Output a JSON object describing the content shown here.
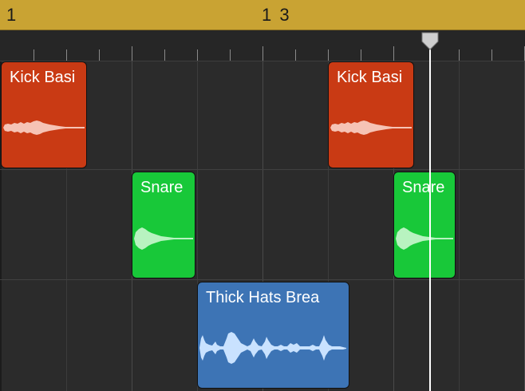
{
  "cycle_bar": {
    "start_label": "1",
    "marker_label": "1 3"
  },
  "regions": {
    "kick_1": {
      "name": "Kick Basi"
    },
    "kick_2": {
      "name": "Kick Basi"
    },
    "snare_1": {
      "name": "Snare"
    },
    "snare_2": {
      "name": "Snare"
    },
    "hats_1": {
      "name": "Thick Hats Brea"
    }
  },
  "colors": {
    "cycle_bar": "#c9a333",
    "kick_region": "#c93a14",
    "snare_region": "#18c839",
    "hats_region": "#3d74b5",
    "playhead": "#ffffff"
  },
  "icons": {
    "playhead": "playhead-icon"
  }
}
